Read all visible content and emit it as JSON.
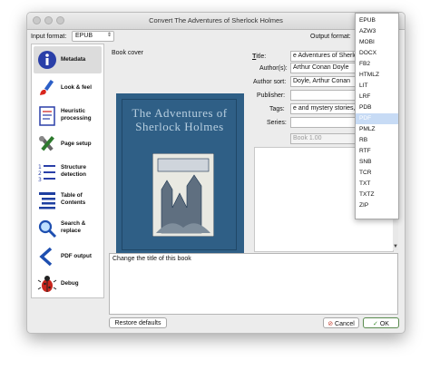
{
  "window": {
    "title": "Convert The Adventures of Sherlock Holmes"
  },
  "input_format": {
    "label": "Input format:",
    "value": "EPUB"
  },
  "output_format": {
    "label": "Output format:"
  },
  "sidebar": {
    "items": [
      {
        "label": "Metadata",
        "icon": "info-icon",
        "selected": true
      },
      {
        "label": "Look & feel",
        "icon": "brush-icon"
      },
      {
        "label": "Heuristic processing",
        "icon": "document-icon"
      },
      {
        "label": "Page setup",
        "icon": "wrench-icon"
      },
      {
        "label": "Structure detection",
        "icon": "list-icon"
      },
      {
        "label": "Table of Contents",
        "icon": "toc-icon"
      },
      {
        "label": "Search & replace",
        "icon": "magnifier-icon"
      },
      {
        "label": "PDF output",
        "icon": "chevron-left-icon"
      },
      {
        "label": "Debug",
        "icon": "bug-icon"
      }
    ]
  },
  "cover": {
    "label": "Book cover",
    "title": "The Adventures of Sherlock Holmes"
  },
  "metadata": {
    "title_label": "Title:",
    "title_value": "e Adventures of Sherlock Holmes",
    "author_label": "Author(s):",
    "author_value": "Arthur Conan Doyle",
    "author_sort_label": "Author sort:",
    "author_sort_value": "Doyle, Arthur Conan",
    "publisher_label": "Publisher:",
    "publisher_value": "",
    "tags_label": "Tags:",
    "tags_value": "e and mystery stories, E",
    "series_label": "Series:",
    "series_value": "",
    "series_index_value": "Book 1.00"
  },
  "description": "Change the title of this book",
  "buttons": {
    "restore": "Restore defaults",
    "cancel": "Cancel",
    "ok": "OK"
  },
  "format_dropdown": {
    "options": [
      "EPUB",
      "AZW3",
      "MOBI",
      "DOCX",
      "FB2",
      "HTMLZ",
      "LIT",
      "LRF",
      "PDB",
      "PDF",
      "PMLZ",
      "RB",
      "RTF",
      "SNB",
      "TCR",
      "TXT",
      "TXTZ",
      "ZIP"
    ],
    "highlighted": "PDF"
  },
  "colors": {
    "cover_blue": "#2f5f86",
    "highlight": "#c7dbf5",
    "ok_green": "#3a8a2e",
    "cancel_red": "#c0392b"
  }
}
